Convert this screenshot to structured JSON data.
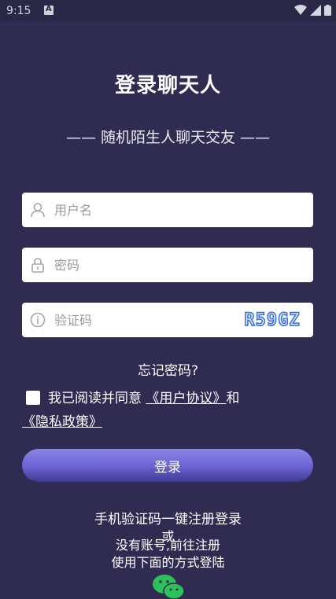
{
  "status_bar": {
    "time": "9:15"
  },
  "header": {
    "title": "登录聊天人",
    "subtitle": "—— 随机陌生人聊天交友 ——"
  },
  "form": {
    "username_placeholder": "用户名",
    "password_placeholder": "密码",
    "captcha_placeholder": "验证码",
    "captcha_text": "R59GZ"
  },
  "links": {
    "forgot": "忘记密码?",
    "agree_prefix": "我已阅读并同意 ",
    "user_agreement": "《用户协议》",
    "and": "和",
    "privacy_policy": "《隐私政策》"
  },
  "buttons": {
    "login": "登录"
  },
  "alt": {
    "sms_login": "手机验证码一键注册登录",
    "or": "或",
    "register": "没有账号,前往注册",
    "other_methods": "使用下面的方式登陆"
  },
  "colors": {
    "background": "#2f2b51",
    "button": "#6a62d2"
  },
  "icons": [
    "user-icon",
    "lock-icon",
    "info-icon",
    "wechat-icon"
  ]
}
